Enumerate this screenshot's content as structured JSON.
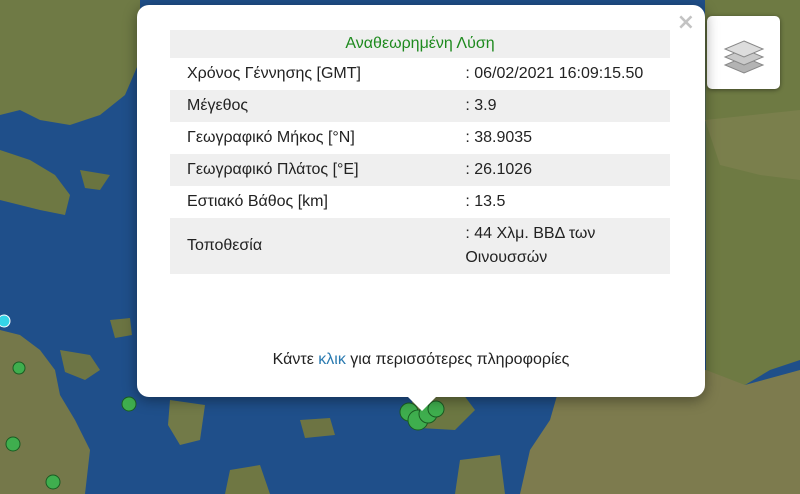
{
  "popup": {
    "title": "Αναθεωρημένη Λύση",
    "close_icon": "×",
    "rows": [
      {
        "label": "Χρόνος Γέννησης [GMT]",
        "value": ": 06/02/2021 16:09:15.50"
      },
      {
        "label": "Μέγεθος",
        "value": ": 3.9"
      },
      {
        "label": "Γεωγραφικό Μήκος [°N]",
        "value": ": 38.9035"
      },
      {
        "label": "Γεωγραφικό Πλάτος [°E]",
        "value": ": 26.1026"
      },
      {
        "label": "Εστιακό Βάθος [km]",
        "value": ": 13.5"
      },
      {
        "label": "Τοποθεσία",
        "value": ": 44 Χλμ. ΒΒΔ των Οινουσσών"
      }
    ],
    "footer": {
      "before": "Κάντε",
      "link": "κλικ",
      "after": "για περισσότερες πληροφορίες"
    }
  },
  "controls": {
    "layers_icon": "layers-icon"
  },
  "colors": {
    "title_green": "#1e8a1e",
    "link_blue": "#2a7ab0",
    "marker_green": "#3fae4e",
    "marker_cyan": "#35d4e8",
    "sea": "#1f4f8a",
    "land": "#6f7a45"
  }
}
